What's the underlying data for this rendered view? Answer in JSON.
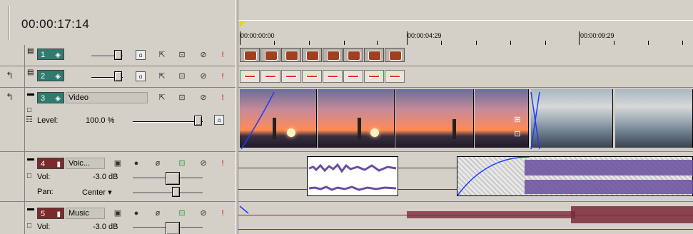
{
  "timecode": "00:00:17:14",
  "ruler": {
    "labels": [
      "00:00:00:00",
      "00:00:04:29",
      "00:00:09:29"
    ]
  },
  "tracks": {
    "t1": {
      "number": "1",
      "type": "video"
    },
    "t2": {
      "number": "2",
      "type": "video"
    },
    "t3": {
      "number": "3",
      "type": "video",
      "name": "Video",
      "level_label": "Level:",
      "level_value": "100.0 %"
    },
    "t4": {
      "number": "4",
      "type": "audio",
      "name": "Voic...",
      "vol_label": "Vol:",
      "vol_value": "-3.0 dB",
      "pan_label": "Pan:",
      "pan_value": "Center ▾"
    },
    "t5": {
      "number": "5",
      "type": "audio",
      "name": "Music",
      "vol_label": "Vol:",
      "vol_value": "-3.0 dB"
    }
  },
  "icons": {
    "track_video": "film-icon",
    "track_audio": "speaker-icon",
    "composite": "composite-icon",
    "motion": "motion-icon",
    "fx": "fx-icon",
    "mute": "mute-icon",
    "solo": "solo-icon",
    "record": "record-icon",
    "phase": "phase-invert-icon"
  },
  "colors": {
    "video_track": "#2f7b6f",
    "audio_track": "#7a2a2a",
    "waveform_voice": "#6a4ea0",
    "waveform_music": "#7a2a3a",
    "cursor": "#e8d800"
  }
}
